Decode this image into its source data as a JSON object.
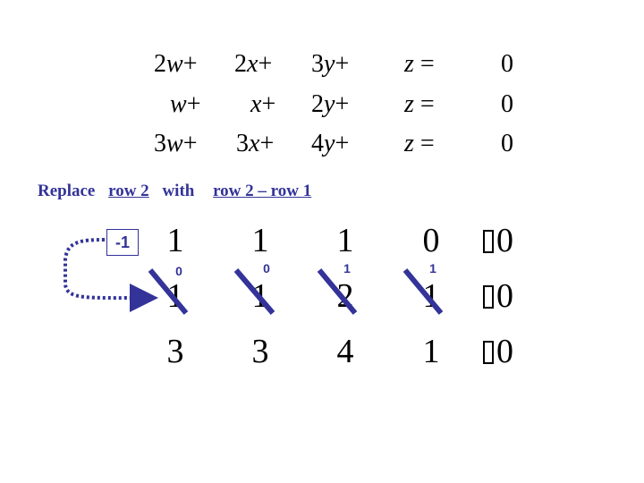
{
  "equations": [
    {
      "terms": [
        "2w+",
        "2x+",
        "3y+",
        "z =",
        "0"
      ]
    },
    {
      "terms": [
        "w+",
        "x+",
        "2y+",
        "z =",
        "0"
      ]
    },
    {
      "terms": [
        "3w+",
        "3x+",
        "4y+",
        "z =",
        "0"
      ]
    }
  ],
  "caption": {
    "replace": "Replace",
    "target": "row 2",
    "with": "with",
    "expression": "row 2 – row 1"
  },
  "multiplier": "-1",
  "matrix": {
    "rows": [
      [
        "1",
        "1",
        "1",
        "0"
      ],
      [
        "1",
        "1",
        "2",
        "1"
      ],
      [
        "3",
        "3",
        "4",
        "1"
      ]
    ],
    "augmented": [
      "0",
      "0",
      "0"
    ],
    "new_row2": [
      "0",
      "0",
      "1",
      "1"
    ]
  },
  "colors": {
    "accent": "#333399",
    "text": "#000000"
  }
}
